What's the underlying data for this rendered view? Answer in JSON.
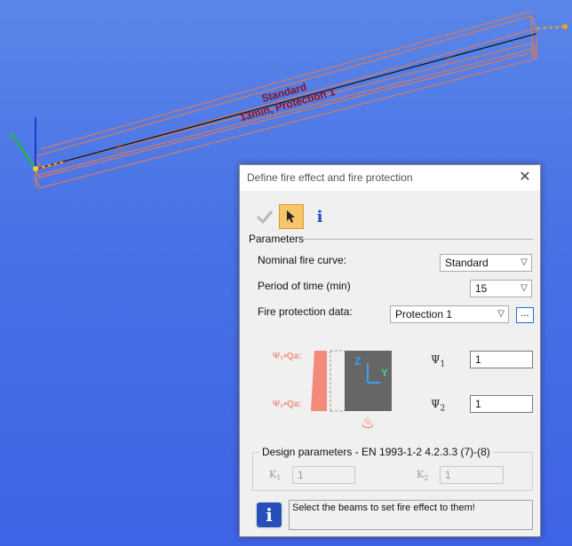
{
  "scene": {
    "beam_label_line1": "Standard",
    "beam_label_line2": "13min, Protection 1"
  },
  "dialog": {
    "title": "Define fire effect and fire protection",
    "toolbar": {
      "ok_icon": "checkmark-icon",
      "select_icon": "pointer-icon",
      "info_icon": "info-icon"
    },
    "parameters_label": "Parameters",
    "nominal_fire_curve": {
      "label": "Nominal fire curve:",
      "value": "Standard"
    },
    "period_of_time": {
      "label": "Period of time (min)",
      "value": "15"
    },
    "fire_protection_data": {
      "label": "Fire protection data:",
      "value": "Protection 1",
      "browse_label": "..."
    },
    "diagram": {
      "psi1_qa": "Ψ₁•Qa:",
      "psi2_qa": "Ψ₂•Qa:",
      "axis_z": "Z",
      "axis_y": "Y"
    },
    "psi1": {
      "symbol": "Ψ",
      "sub": "1",
      "value": "1"
    },
    "psi2": {
      "symbol": "Ψ",
      "sub": "2",
      "value": "1"
    },
    "design_params": {
      "title": "Design parameters - EN 1993-1-2 4.2.3.3 (7)-(8)",
      "k1": {
        "symbol": "K",
        "sub": "1",
        "value": "1"
      },
      "k2": {
        "symbol": "K",
        "sub": "2",
        "value": "1"
      }
    },
    "message": "Select the beams to set fire effect to them!",
    "colors": {
      "accent_active": "#f8c468",
      "info_blue": "#2450b8",
      "flame": "#f26a4f"
    }
  }
}
